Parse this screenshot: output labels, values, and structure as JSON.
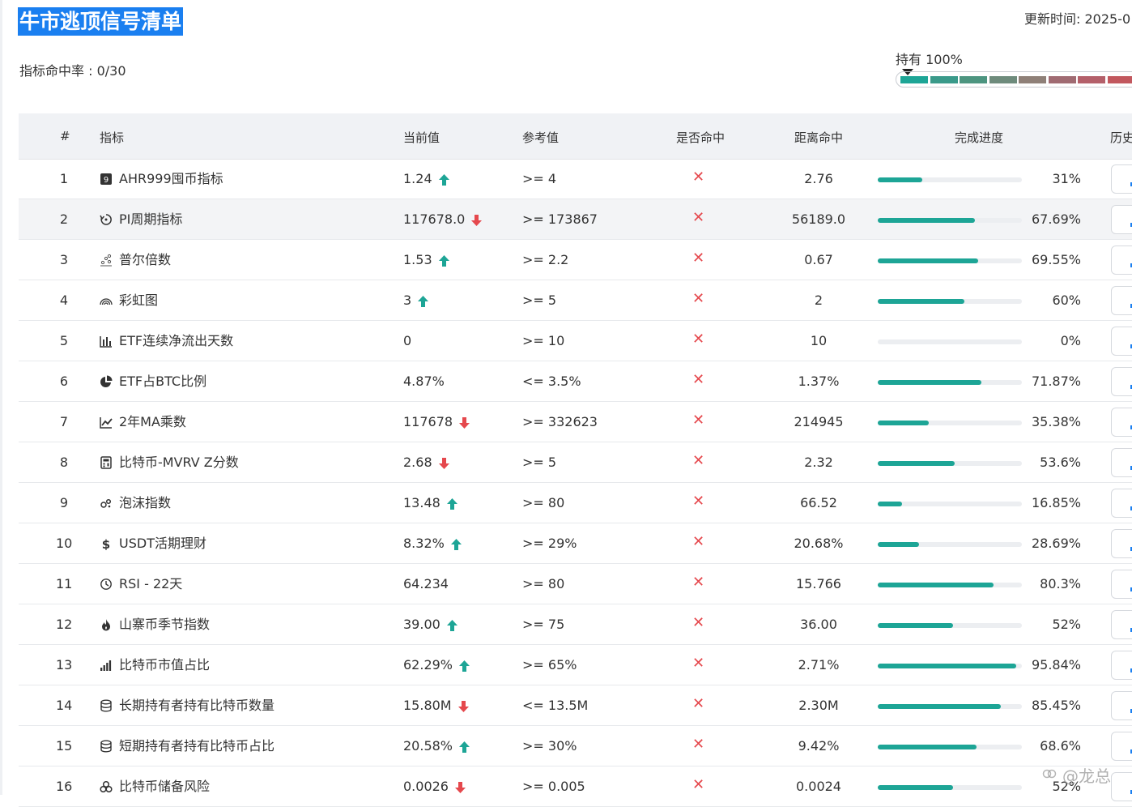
{
  "page": {
    "title": "牛市逃顶信号清单",
    "hit_rate": "指标命中率 : 0/30",
    "updated": "更新时间: 2025-0",
    "hold_label": "持有 100%",
    "gauge_colors": [
      "#1da596",
      "#3a9a8a",
      "#4d9580",
      "#6e8b7c",
      "#8f8078",
      "#a06b72",
      "#b4606a",
      "#c2585e"
    ]
  },
  "table": {
    "headers": {
      "num": "#",
      "indicator": "指标",
      "current": "当前值",
      "reference": "参考值",
      "hit": "是否命中",
      "distance": "距离命中",
      "progress": "完成进度",
      "history": "历史"
    },
    "rows": [
      {
        "num": "1",
        "icon": "nine-badge-icon",
        "name": "AHR999囤币指标",
        "current": "1.24",
        "trend": "up",
        "reference": ">= 4",
        "hit": "✕",
        "distance": "2.76",
        "progress": 0.31,
        "pct": "31%"
      },
      {
        "num": "2",
        "icon": "cycle-icon",
        "name": "PI周期指标",
        "current": "117678.0",
        "trend": "down",
        "reference": ">= 173867",
        "hit": "✕",
        "distance": "56189.0",
        "progress": 0.6769,
        "pct": "67.69%"
      },
      {
        "num": "3",
        "icon": "scatter-icon",
        "name": "普尔倍数",
        "current": "1.53",
        "trend": "up",
        "reference": ">= 2.2",
        "hit": "✕",
        "distance": "0.67",
        "progress": 0.6955,
        "pct": "69.55%"
      },
      {
        "num": "4",
        "icon": "rainbow-icon",
        "name": "彩虹图",
        "current": "3",
        "trend": "up",
        "reference": ">= 5",
        "hit": "✕",
        "distance": "2",
        "progress": 0.6,
        "pct": "60%"
      },
      {
        "num": "5",
        "icon": "bar-chart-icon",
        "name": "ETF连续净流出天数",
        "current": "0",
        "trend": "",
        "reference": ">= 10",
        "hit": "✕",
        "distance": "10",
        "progress": 0.0,
        "pct": "0%"
      },
      {
        "num": "6",
        "icon": "pie-chart-icon",
        "name": "ETF占BTC比例",
        "current": "4.87%",
        "trend": "",
        "reference": "<= 3.5%",
        "hit": "✕",
        "distance": "1.37%",
        "progress": 0.7187,
        "pct": "71.87%"
      },
      {
        "num": "7",
        "icon": "line-chart-icon",
        "name": "2年MA乘数",
        "current": "117678",
        "trend": "down",
        "reference": ">= 332623",
        "hit": "✕",
        "distance": "214945",
        "progress": 0.3538,
        "pct": "35.38%"
      },
      {
        "num": "8",
        "icon": "calculator-icon",
        "name": "比特币-MVRV Z分数",
        "current": "2.68",
        "trend": "down",
        "reference": ">= 5",
        "hit": "✕",
        "distance": "2.32",
        "progress": 0.536,
        "pct": "53.6%"
      },
      {
        "num": "9",
        "icon": "bubbles-icon",
        "name": "泡沫指数",
        "current": "13.48",
        "trend": "up",
        "reference": ">= 80",
        "hit": "✕",
        "distance": "66.52",
        "progress": 0.1685,
        "pct": "16.85%"
      },
      {
        "num": "10",
        "icon": "dollar-icon",
        "name": "USDT活期理财",
        "current": "8.32%",
        "trend": "up",
        "reference": ">= 29%",
        "hit": "✕",
        "distance": "20.68%",
        "progress": 0.2869,
        "pct": "28.69%"
      },
      {
        "num": "11",
        "icon": "clock-icon",
        "name": "RSI - 22天",
        "current": "64.234",
        "trend": "",
        "reference": ">= 80",
        "hit": "✕",
        "distance": "15.766",
        "progress": 0.803,
        "pct": "80.3%"
      },
      {
        "num": "12",
        "icon": "fire-icon",
        "name": "山寨币季节指数",
        "current": "39.00",
        "trend": "up",
        "reference": ">= 75",
        "hit": "✕",
        "distance": "36.00",
        "progress": 0.52,
        "pct": "52%"
      },
      {
        "num": "13",
        "icon": "rising-bars-icon",
        "name": "比特币市值占比",
        "current": "62.29%",
        "trend": "up",
        "reference": ">= 65%",
        "hit": "✕",
        "distance": "2.71%",
        "progress": 0.9584,
        "pct": "95.84%"
      },
      {
        "num": "14",
        "icon": "database-icon",
        "name": "长期持有者持有比特币数量",
        "current": "15.80M",
        "trend": "down",
        "reference": "<= 13.5M",
        "hit": "✕",
        "distance": "2.30M",
        "progress": 0.8545,
        "pct": "85.45%"
      },
      {
        "num": "15",
        "icon": "database-icon",
        "name": "短期持有者持有比特币占比",
        "current": "20.58%",
        "trend": "up",
        "reference": ">= 30%",
        "hit": "✕",
        "distance": "9.42%",
        "progress": 0.686,
        "pct": "68.6%"
      },
      {
        "num": "16",
        "icon": "biohazard-icon",
        "name": "比特币储备风险",
        "current": "0.0026",
        "trend": "down",
        "reference": ">= 0.005",
        "hit": "✕",
        "distance": "0.0024",
        "progress": 0.52,
        "pct": "52%"
      }
    ]
  },
  "watermark": "@龙总"
}
